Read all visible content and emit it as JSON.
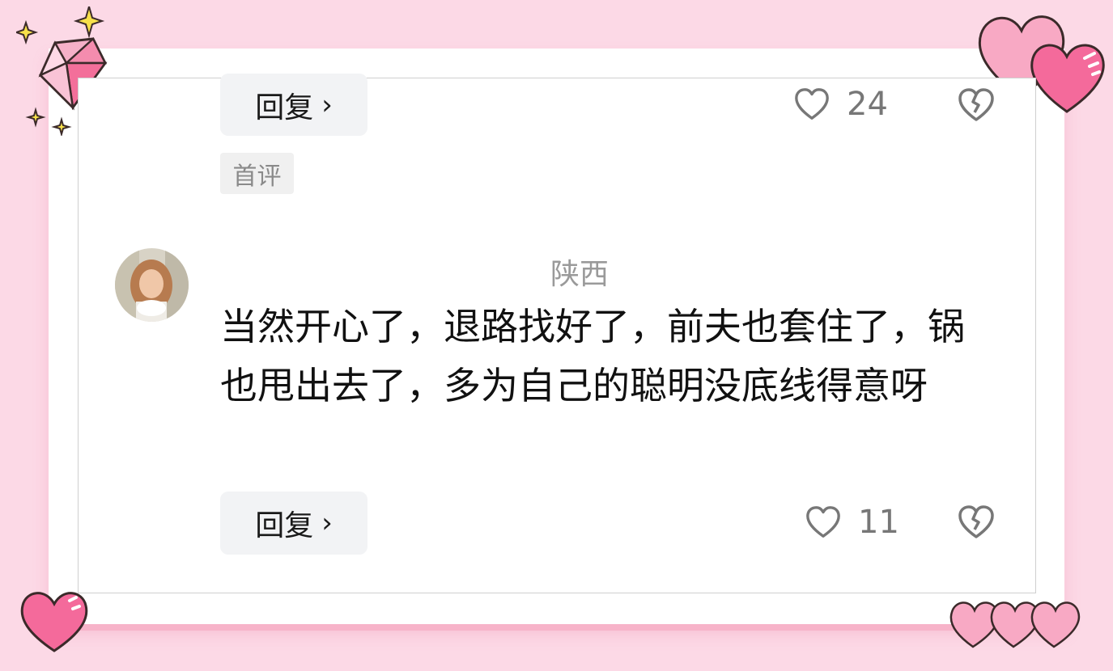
{
  "comment_prev": {
    "reply_label": "回复",
    "like_count": "24",
    "tag": "首评"
  },
  "comment": {
    "location": "陕西",
    "text": "当然开心了，退路找好了，前夫也套住了，锅也甩出去了，多为自己的聪明没底线得意呀",
    "reply_label": "回复",
    "like_count": "11"
  },
  "icons": {
    "like": "heart-outline-icon",
    "dislike": "broken-heart-icon",
    "reply_arrow": "chevron-right-icon"
  },
  "colors": {
    "background": "#fcd9e6",
    "heart_pink": "#f46a9b",
    "text_gray": "#9a9a9a"
  }
}
